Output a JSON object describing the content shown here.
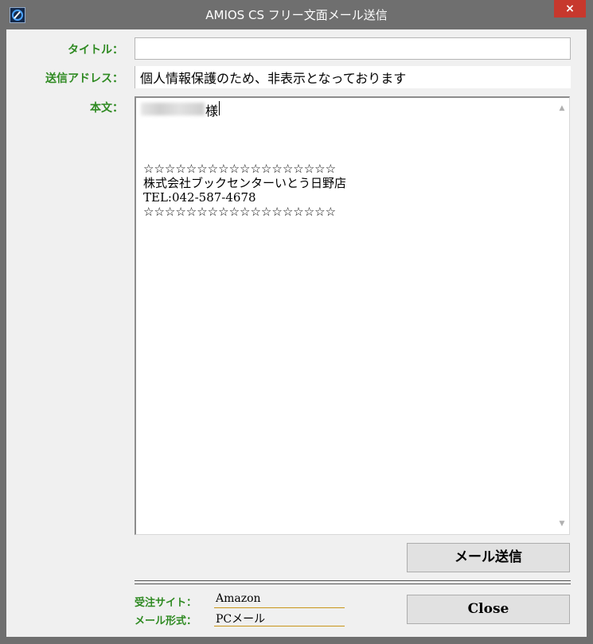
{
  "window": {
    "title": "AMIOS CS フリー文面メール送信",
    "close_glyph": "×"
  },
  "form": {
    "title_label": "タイトル：",
    "title_value": "",
    "address_label": "送信アドレス：",
    "address_value": "個人情報保護のため、非表示となっております",
    "body_label": "本文："
  },
  "body": {
    "salutation_suffix": "様",
    "lines": [
      "☆☆☆☆☆☆☆☆☆☆☆☆☆☆☆☆☆☆",
      "株式会社ブックセンターいとう日野店",
      "TEL:042-587-4678",
      "☆☆☆☆☆☆☆☆☆☆☆☆☆☆☆☆☆☆"
    ]
  },
  "buttons": {
    "send_label": "メール送信",
    "close_label": "Close"
  },
  "info": {
    "site_label": "受注サイト：",
    "site_value": "Amazon",
    "mail_type_label": "メール形式：",
    "mail_type_value": "PCメール"
  },
  "colors": {
    "label_green": "#2f8a22",
    "close_red": "#c7382d",
    "underline_gold": "#c9951a"
  },
  "icons": {
    "app": "app-logo-icon",
    "close": "close-icon",
    "scroll_up": "chevron-up-icon",
    "scroll_down": "chevron-down-icon"
  }
}
